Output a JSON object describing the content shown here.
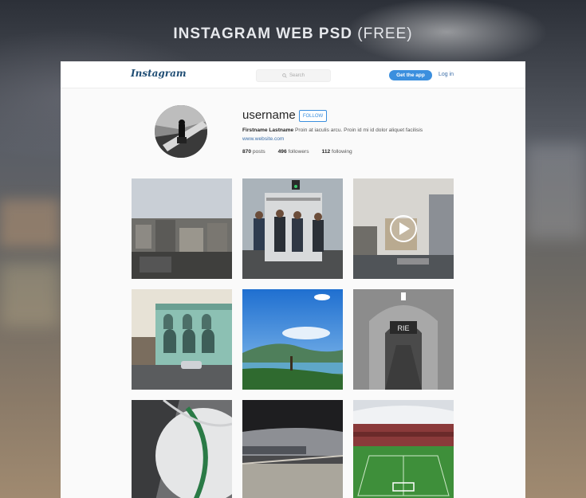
{
  "headline": {
    "main": "INSTAGRAM WEB PSD",
    "suffix": "(FREE)"
  },
  "topbar": {
    "logo": "Instagram",
    "search_placeholder": "Search",
    "get_app_label": "Get the app",
    "login_label": "Log in",
    "accent_color": "#3b8fde"
  },
  "profile": {
    "username": "username",
    "follow_label": "FOLLOW",
    "full_name": "Firstname Lastname",
    "bio": "Proin at iaculis arcu. Proin id mi id dolor aliquet facilisis",
    "website": "www.website.com",
    "stats": {
      "posts_count": "870",
      "posts_label": "posts",
      "followers_count": "496",
      "followers_label": "followers",
      "following_count": "112",
      "following_label": "following"
    }
  },
  "posts": [
    {
      "subject": "city rooftops"
    },
    {
      "subject": "workers on truck"
    },
    {
      "subject": "street video",
      "video": true
    },
    {
      "subject": "teal colonial building"
    },
    {
      "subject": "blue sky coastline"
    },
    {
      "subject": "tunnel"
    },
    {
      "subject": "curved railing"
    },
    {
      "subject": "train station"
    },
    {
      "subject": "football stadium"
    }
  ]
}
